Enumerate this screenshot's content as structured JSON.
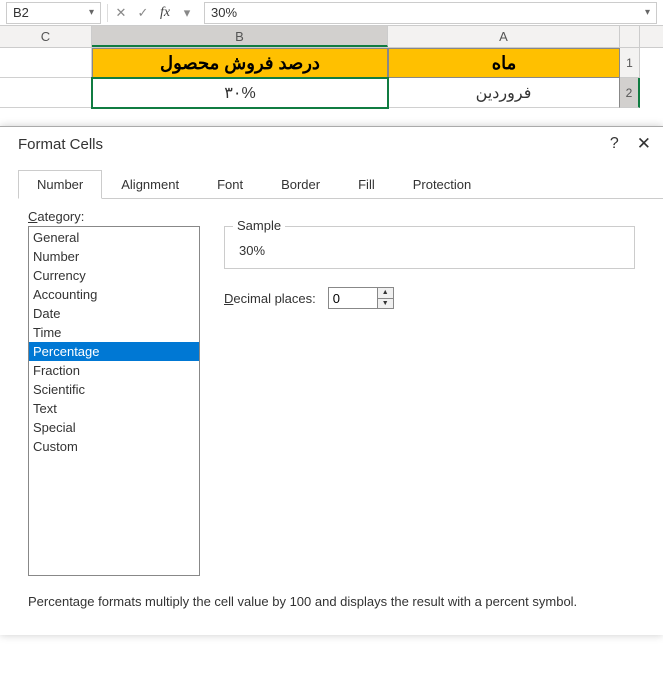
{
  "formula_bar": {
    "cell_ref": "B2",
    "value": "30%"
  },
  "columns": {
    "c": "C",
    "b": "B",
    "a": "A"
  },
  "rows": {
    "r1": "1",
    "r2": "2"
  },
  "sheet": {
    "b1": "درصد فروش محصول",
    "a1": "ماه",
    "b2": "۳۰%",
    "a2": "فروردین"
  },
  "dialog": {
    "title": "Format Cells",
    "tabs": {
      "number": "Number",
      "alignment": "Alignment",
      "font": "Font",
      "border": "Border",
      "fill": "Fill",
      "protection": "Protection"
    },
    "category_label": "Category:",
    "categories": {
      "general": "General",
      "number": "Number",
      "currency": "Currency",
      "accounting": "Accounting",
      "date": "Date",
      "time": "Time",
      "percentage": "Percentage",
      "fraction": "Fraction",
      "scientific": "Scientific",
      "text": "Text",
      "special": "Special",
      "custom": "Custom"
    },
    "sample_label": "Sample",
    "sample_value": "30%",
    "decimal_label": "Decimal places:",
    "decimal_value": "0",
    "description": "Percentage formats multiply the cell value by 100 and displays the result with a percent symbol."
  }
}
